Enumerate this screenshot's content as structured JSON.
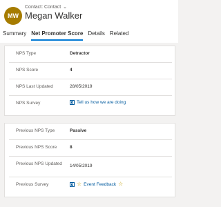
{
  "header": {
    "avatar_initials": "MW",
    "entity_label": "Contact: Contact",
    "name": "Megan Walker"
  },
  "tabs": [
    {
      "label": "Summary",
      "active": false
    },
    {
      "label": "Net Promoter Score",
      "active": true
    },
    {
      "label": "Details",
      "active": false
    },
    {
      "label": "Related",
      "active": false
    }
  ],
  "nps_section": {
    "rows": [
      {
        "label": "NPS Type",
        "value": "Detractor"
      },
      {
        "label": "NPS Score",
        "value": "4"
      },
      {
        "label": "NPS Last Updated",
        "value": "28/05/2019"
      },
      {
        "label": "NPS Survey",
        "value": "Tell us how we are doing"
      }
    ]
  },
  "previous_section": {
    "rows": [
      {
        "label": "Previous NPS Type",
        "value": "Passive"
      },
      {
        "label": "Previous NPS Score",
        "value": "8"
      },
      {
        "label": "Previous NPS Updated",
        "value": "14/05/2019"
      },
      {
        "label": "Previous Survey",
        "value": "Event Feedback"
      }
    ]
  },
  "icons": {
    "survey_icon": "form-icon",
    "star_icon": "star-icon",
    "chevron": "chevron-down-icon"
  },
  "colors": {
    "accent": "#0078d4",
    "link": "#005a9e",
    "avatar": "#a67c00",
    "star": "#c19c00"
  }
}
